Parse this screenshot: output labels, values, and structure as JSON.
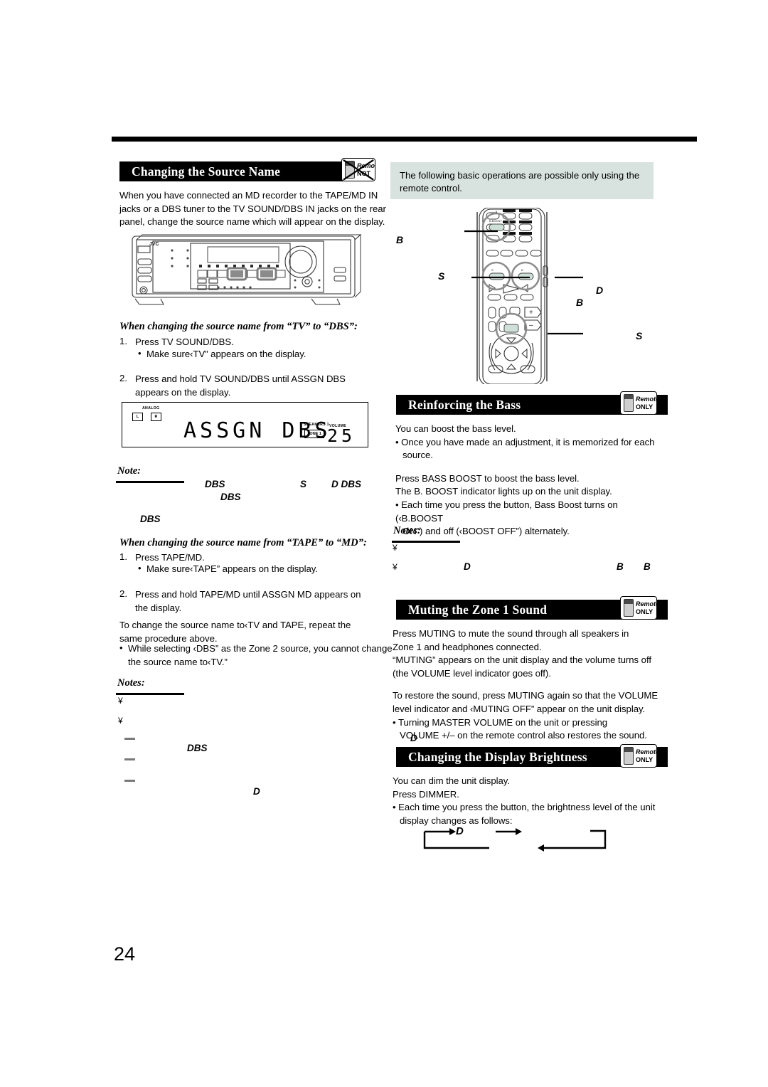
{
  "page": {
    "number": "24"
  },
  "left": {
    "section1": {
      "title": "Changing the Source Name",
      "badge": "remote-not"
    },
    "intro": "When you have connected an MD recorder to the TAPE/MD IN jacks or a DBS tuner to the TV SOUND/DBS IN jacks on the rear panel, change the source name which will appear on the display.",
    "receiver": {
      "brand": "JVC"
    },
    "proc1": {
      "heading": "When changing the source name from “TV” to “DBS”:",
      "steps": [
        {
          "num": "1.",
          "text": "Press TV SOUND/DBS."
        },
        {
          "bullet": "•",
          "text": "Make sure‹TV” appears on the display."
        },
        {
          "num": "2.",
          "text": "Press and hold TV SOUND/DBS until ASSGN DBS appears on the display."
        }
      ]
    },
    "display": {
      "analog_label": "ANALOG",
      "ch_left": "L",
      "ch_right": "R",
      "main_text": "ASSGN DBS",
      "speakers_label": "SPEAKERS 1",
      "zone_label": "ZONE 1",
      "volume_label": "VOLUME",
      "volume_value": "25"
    },
    "note1": {
      "heading": "Note:",
      "fragments": [
        {
          "text": "DBS"
        },
        {
          "text": "S"
        },
        {
          "text": "D DBS"
        },
        {
          "text": "DBS"
        },
        {
          "text": "DBS"
        }
      ]
    },
    "proc2": {
      "heading": "When changing the source name from “TAPE” to “MD”:",
      "steps": [
        {
          "num": "1.",
          "text": "Press TAPE/MD."
        },
        {
          "bullet": "•",
          "text": "Make sure‹TAPE” appears on the display."
        },
        {
          "num": "2.",
          "text": "Press and hold TAPE/MD until  ASSGN MD  appears on the display."
        }
      ],
      "after1": "To change the source name to‹TV  and  TAPE,  repeat the same procedure above.",
      "after2": "While selecting ‹DBS” as the Zone 2 source, you cannot change the source name to‹TV.”"
    },
    "notes2": {
      "heading": "Notes:",
      "markers": [
        "¥",
        "¥"
      ],
      "dashes": 3,
      "fragments": [
        {
          "text": "DBS"
        },
        {
          "text": "D"
        }
      ]
    }
  },
  "right": {
    "callout": "The following basic operations are possible only using the remote control.",
    "remote_callouts": [
      {
        "label": "B"
      },
      {
        "label": "S"
      },
      {
        "label": "D"
      },
      {
        "label": "B"
      },
      {
        "label": "S"
      }
    ],
    "section2": {
      "title": "Reinforcing the Bass",
      "badge_line1": "Remote",
      "badge_line2": "ONLY",
      "lines": [
        "You can boost the bass level.",
        "• Once you have made an adjustment, it is memorized for each",
        "source.",
        "Press BASS BOOST to boost the bass level.",
        "The B. BOOST indicator lights up on the unit display.",
        "• Each time you press the button, Bass Boost turns on (‹B.BOOST",
        "ON”) and off (‹BOOST OFF”) alternately."
      ]
    },
    "notes3": {
      "heading": "Notes:",
      "markers": [
        "¥",
        "¥"
      ],
      "fragments": [
        {
          "text": "D"
        },
        {
          "text": "B"
        },
        {
          "text": "B"
        }
      ]
    },
    "section3": {
      "title": "Muting the Zone 1 Sound",
      "badge_line1": "Remote",
      "badge_line2": "ONLY",
      "lines": [
        "Press MUTING to mute the sound through all speakers in",
        "Zone 1 and headphones connected.",
        "“MUTING” appears on the unit display and the volume turns off",
        "(the VOLUME level indicator goes off).",
        "To restore the sound, press MUTING again so that the VOLUME",
        "level indicator and ‹MUTING OFF” appear on the unit display.",
        "• Turning MASTER VOLUME on the unit or pressing",
        "VOLUME +/– on the remote control also restores the sound."
      ],
      "stray_fragment": "D"
    },
    "section4": {
      "title": "Changing the Display Brightness",
      "badge_line1": "Remote",
      "badge_line2": "ONLY",
      "lines": [
        "You can dim the unit display.",
        "Press DIMMER.",
        "• Each time you press the button, the brightness level of the unit",
        "display changes as follows:"
      ],
      "flow_fragment": "D"
    }
  }
}
